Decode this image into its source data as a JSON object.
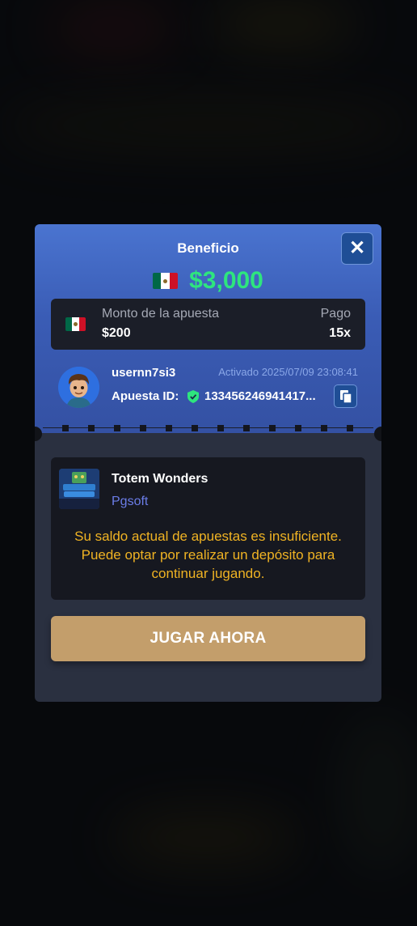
{
  "modal": {
    "title": "Beneficio",
    "close_icon": "close-icon",
    "prize_amount": "$3,000",
    "flag_icon": "mexico-flag-icon"
  },
  "bet": {
    "amount_label": "Monto de la apuesta",
    "amount_value": "$200",
    "pay_label": "Pago",
    "pay_value": "15x"
  },
  "user": {
    "username": "usernn7si3",
    "activated": "Activado 2025/07/09 23:08:41",
    "bet_id_label": "Apuesta ID:",
    "bet_id": "133456246941417...",
    "copy_icon": "copy-icon",
    "verified_icon": "shield-check-icon"
  },
  "game": {
    "name": "Totem Wonders",
    "provider": "Pgsoft",
    "warning": "Su saldo actual de apuestas es insuficiente. Puede optar por realizar un depósito para continuar jugando."
  },
  "actions": {
    "play_label": "JUGAR AHORA"
  },
  "colors": {
    "accent_green": "#2ee57e",
    "warning_yellow": "#f0b323",
    "provider_blue": "#6b7de8",
    "play_button": "#c39e6b",
    "header_blue": "#4a74d0"
  }
}
